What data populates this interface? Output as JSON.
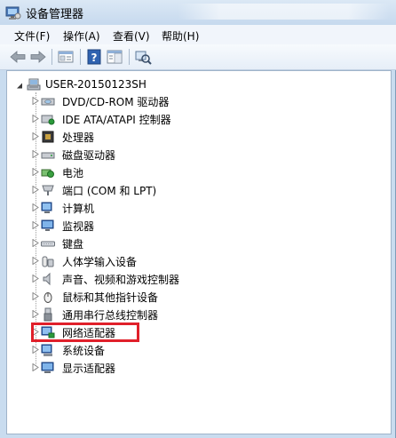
{
  "window": {
    "title": "设备管理器"
  },
  "menu": [
    {
      "label": "文件(F)"
    },
    {
      "label": "操作(A)"
    },
    {
      "label": "查看(V)"
    },
    {
      "label": "帮助(H)"
    }
  ],
  "toolbar": {
    "buttons": [
      {
        "icon": "back-arrow-icon"
      },
      {
        "icon": "forward-arrow-icon"
      },
      {
        "icon": "properties-icon"
      },
      {
        "icon": "help-icon"
      },
      {
        "icon": "action-pane-icon"
      },
      {
        "icon": "scan-hardware-icon"
      }
    ]
  },
  "tree": {
    "root": {
      "label": "USER-20150123SH",
      "icon": "computer-icon"
    },
    "items": [
      {
        "label": "DVD/CD-ROM 驱动器",
        "icon": "dvd-drive-icon"
      },
      {
        "label": "IDE ATA/ATAPI 控制器",
        "icon": "ide-controller-icon"
      },
      {
        "label": "处理器",
        "icon": "processor-icon"
      },
      {
        "label": "磁盘驱动器",
        "icon": "disk-drive-icon"
      },
      {
        "label": "电池",
        "icon": "battery-icon"
      },
      {
        "label": "端口 (COM 和 LPT)",
        "icon": "port-icon"
      },
      {
        "label": "计算机",
        "icon": "computer-icon"
      },
      {
        "label": "监视器",
        "icon": "monitor-icon"
      },
      {
        "label": "键盘",
        "icon": "keyboard-icon"
      },
      {
        "label": "人体学输入设备",
        "icon": "hid-icon"
      },
      {
        "label": "声音、视频和游戏控制器",
        "icon": "speaker-icon"
      },
      {
        "label": "鼠标和其他指针设备",
        "icon": "mouse-icon"
      },
      {
        "label": "通用串行总线控制器",
        "icon": "usb-icon"
      },
      {
        "label": "网络适配器",
        "icon": "network-adapter-icon"
      },
      {
        "label": "系统设备",
        "icon": "system-device-icon"
      },
      {
        "label": "显示适配器",
        "icon": "display-adapter-icon"
      }
    ]
  },
  "colors": {
    "highlight": "#e0202a",
    "window_frame": "#c9dcef"
  }
}
